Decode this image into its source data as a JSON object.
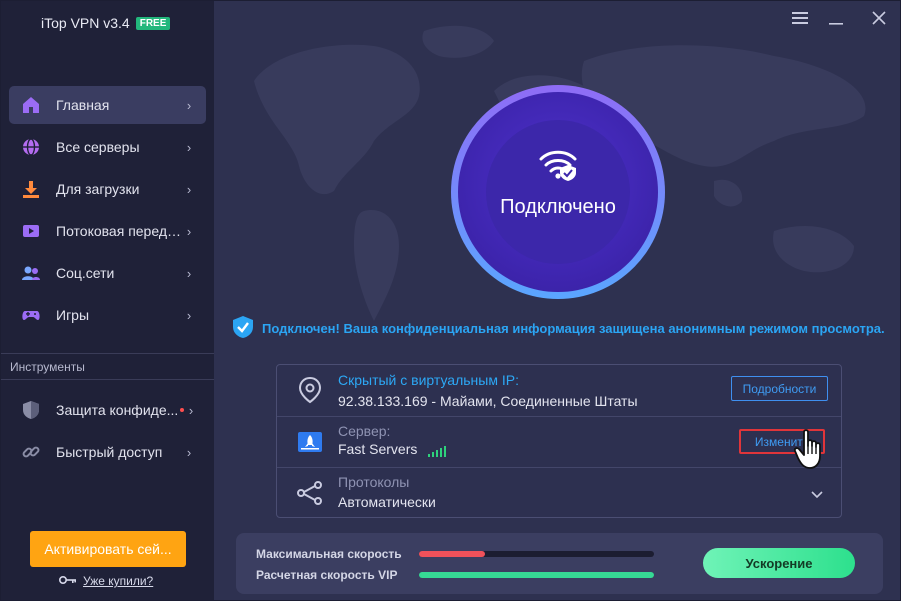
{
  "app": {
    "title": "iTop VPN v3.4",
    "badge": "FREE"
  },
  "sidebar": {
    "items": [
      {
        "label": "Главная",
        "icon": "home-icon",
        "active": true
      },
      {
        "label": "Все серверы",
        "icon": "globe-icon"
      },
      {
        "label": "Для загрузки",
        "icon": "download-icon"
      },
      {
        "label": "Потоковая переда...",
        "icon": "play-icon"
      },
      {
        "label": "Соц.сети",
        "icon": "users-icon"
      },
      {
        "label": "Игры",
        "icon": "gamepad-icon"
      }
    ],
    "tools_header": "Инструменты",
    "tools": [
      {
        "label": "Защита конфиде...",
        "icon": "shield-icon",
        "has_dot": true
      },
      {
        "label": "Быстрый доступ",
        "icon": "link-icon"
      }
    ],
    "activate_label": "Активировать сей...",
    "bought_label": "Уже купили?"
  },
  "window_controls": [
    "menu-icon",
    "minimize-icon",
    "close-icon"
  ],
  "connection": {
    "status_label": "Подключено",
    "message": "Подключен! Ваша конфиденциальная информация защищена анонимным режимом просмотра."
  },
  "info": {
    "ip_title": "Скрытый с виртуальным IP:",
    "ip_value": "92.38.133.169 - Майами, Соединенные Штаты",
    "details_label": "Подробности",
    "server_title": "Сервер:",
    "server_value": "Fast Servers",
    "change_label": "Изменить",
    "protocol_title": "Протоколы",
    "protocol_value": "Автоматически"
  },
  "speed": {
    "max_label": "Максимальная скорость",
    "max_fraction": 0.28,
    "vip_label": "Расчетная скорость VIP",
    "vip_fraction": 1.0,
    "boost_label": "Ускорение"
  },
  "colors": {
    "accent_blue": "#2ba5f4",
    "activate_orange": "#ffa412",
    "boost_green": "#2de08d",
    "speed_red": "#f0515a",
    "highlight_red": "#e0353a"
  }
}
